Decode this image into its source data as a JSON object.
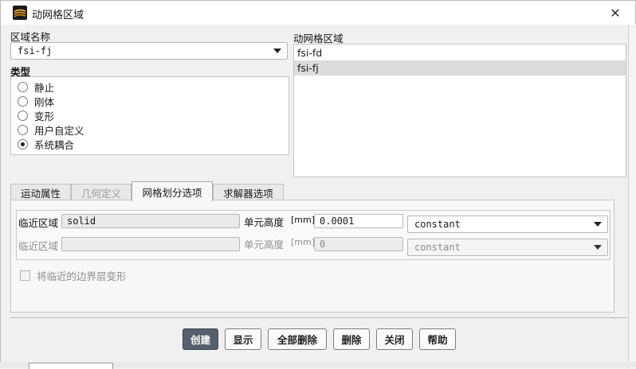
{
  "window": {
    "title": "动网格区域",
    "close_glyph": "✕",
    "icon": "fluent-app-icon"
  },
  "zone_name": {
    "label": "区域名称",
    "value": "fsi-fj"
  },
  "type_group": {
    "label": "类型",
    "options": [
      {
        "label": "静止",
        "checked": false
      },
      {
        "label": "刚体",
        "checked": false
      },
      {
        "label": "变形",
        "checked": false
      },
      {
        "label": "用户自定义",
        "checked": false
      },
      {
        "label": "系统耦合",
        "checked": true
      }
    ]
  },
  "dynamic_zones": {
    "label": "动网格区域",
    "items": [
      {
        "label": "fsi-fd",
        "selected": false
      },
      {
        "label": "fsi-fj",
        "selected": true
      }
    ]
  },
  "tabs": [
    {
      "label": "运动属性",
      "state": "normal"
    },
    {
      "label": "几何定义",
      "state": "disabled"
    },
    {
      "label": "网格划分选项",
      "state": "active"
    },
    {
      "label": "求解器选项",
      "state": "normal"
    }
  ],
  "mesh_options": {
    "rows": [
      {
        "adjacent_label": "临近区域",
        "adjacent_value": "solid",
        "height_label": "单元高度",
        "unit": "[mm]",
        "height_value": "0.0001",
        "method": "constant",
        "enabled": true
      },
      {
        "adjacent_label": "临近区域",
        "adjacent_value": "",
        "height_label": "单元高度",
        "unit": "[mm]",
        "height_value": "0",
        "method": "constant",
        "enabled": false
      }
    ],
    "deform_boundary_layer": {
      "label": "将临近的边界层变形",
      "checked": false
    }
  },
  "buttons": {
    "create": "创建",
    "display": "显示",
    "delete_all": "全部删除",
    "delete": "删除",
    "close": "关闭",
    "help": "帮助"
  }
}
